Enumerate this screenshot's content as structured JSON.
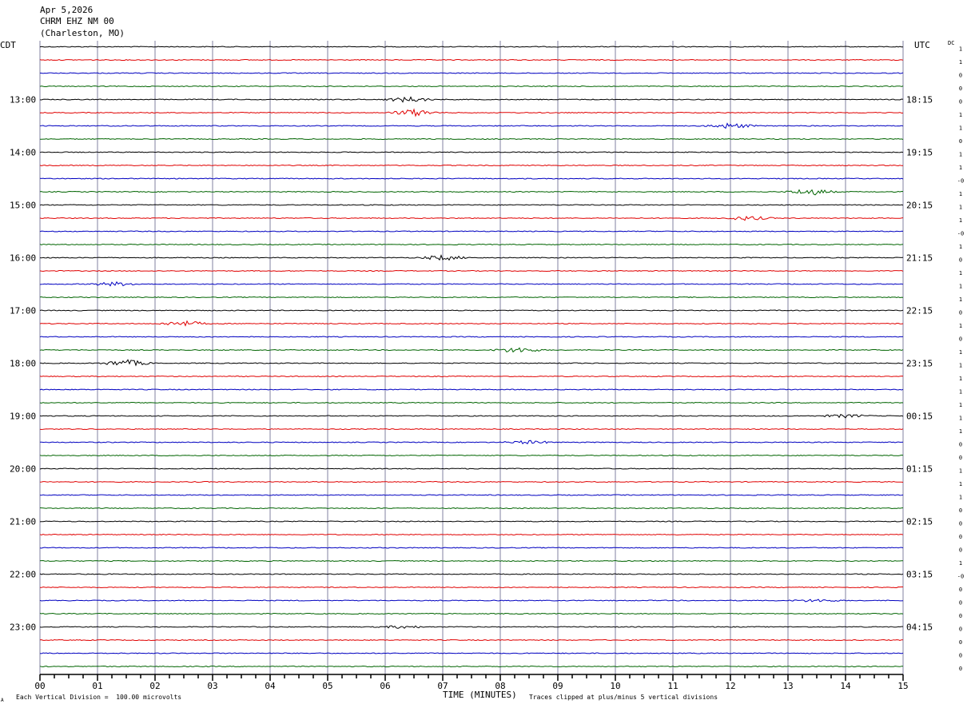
{
  "header": {
    "date": "Apr 5,2026",
    "station": "CHRM EHZ NM 00",
    "location": "(Charleston, MO)"
  },
  "left_axis_label": "CDT",
  "right_axis_label": "UTC",
  "dc_label": "DC",
  "footer": {
    "left_note": "Each Vertical Division =  100.00 microvolts",
    "xlabel": "TIME (MINUTES)",
    "right_note": "Traces clipped at plus/minus 5 vertical divisions",
    "corner_mark": "A"
  },
  "colors": {
    "trace_cycle": [
      "#000000",
      "#e00000",
      "#0000c0",
      "#006400"
    ],
    "vertical_grid": "#8080a0",
    "axis": "#000000"
  },
  "chart_data": {
    "type": "line",
    "title": "",
    "xlabel": "TIME (MINUTES)",
    "ylabel": "",
    "xlim": [
      0,
      15
    ],
    "x_ticks": [
      "00",
      "01",
      "02",
      "03",
      "04",
      "05",
      "06",
      "07",
      "08",
      "09",
      "10",
      "11",
      "12",
      "13",
      "14",
      "15"
    ],
    "trace_count": 48,
    "minutes_per_trace": 15,
    "first_trace_cdt": "12:15",
    "left_hour_labels": [
      {
        "trace": 4,
        "label": "13:00"
      },
      {
        "trace": 8,
        "label": "14:00"
      },
      {
        "trace": 12,
        "label": "15:00"
      },
      {
        "trace": 16,
        "label": "16:00"
      },
      {
        "trace": 20,
        "label": "17:00"
      },
      {
        "trace": 24,
        "label": "18:00"
      },
      {
        "trace": 28,
        "label": "19:00"
      },
      {
        "trace": 32,
        "label": "20:00"
      },
      {
        "trace": 36,
        "label": "21:00"
      },
      {
        "trace": 40,
        "label": "22:00"
      },
      {
        "trace": 44,
        "label": "23:00"
      }
    ],
    "right_hour_labels": [
      {
        "trace": 4,
        "label": "18:15"
      },
      {
        "trace": 8,
        "label": "19:15"
      },
      {
        "trace": 12,
        "label": "20:15"
      },
      {
        "trace": 16,
        "label": "21:15"
      },
      {
        "trace": 20,
        "label": "22:15"
      },
      {
        "trace": 24,
        "label": "23:15"
      },
      {
        "trace": 28,
        "label": "00:15"
      },
      {
        "trace": 32,
        "label": "01:15"
      },
      {
        "trace": 36,
        "label": "02:15"
      },
      {
        "trace": 40,
        "label": "03:15"
      },
      {
        "trace": 44,
        "label": "04:15"
      }
    ],
    "dc_offsets": [
      "1",
      "1",
      "0",
      "0",
      "0",
      "1",
      "1",
      "0",
      "1",
      "1",
      "-0",
      "1",
      "1",
      "1",
      "-0",
      "1",
      "0",
      "1",
      "1",
      "1",
      "0",
      "1",
      "0",
      "1",
      "1",
      "1",
      "1",
      "1",
      "1",
      "1",
      "0",
      "0",
      "1",
      "1",
      "1",
      "0",
      "0",
      "0",
      "0",
      "1",
      "-0",
      "0",
      "0",
      "0",
      "0",
      "0",
      "0",
      "0"
    ],
    "trace_activity": [
      {
        "trace": 4,
        "burst_minute": 6.4,
        "burst_amp": 2.0
      },
      {
        "trace": 5,
        "burst_minute": 6.5,
        "burst_amp": 2.5
      },
      {
        "trace": 6,
        "burst_minute": 12.0,
        "burst_amp": 2.0
      },
      {
        "trace": 11,
        "burst_minute": 13.4,
        "burst_amp": 2.5
      },
      {
        "trace": 13,
        "burst_minute": 12.3,
        "burst_amp": 1.5
      },
      {
        "trace": 16,
        "burst_minute": 7.0,
        "burst_amp": 1.8
      },
      {
        "trace": 18,
        "burst_minute": 1.3,
        "burst_amp": 1.5
      },
      {
        "trace": 21,
        "burst_minute": 2.5,
        "burst_amp": 2.0
      },
      {
        "trace": 23,
        "burst_minute": 8.3,
        "burst_amp": 2.0
      },
      {
        "trace": 24,
        "burst_minute": 1.5,
        "burst_amp": 2.5
      },
      {
        "trace": 28,
        "burst_minute": 14.0,
        "burst_amp": 1.2
      },
      {
        "trace": 30,
        "burst_minute": 8.5,
        "burst_amp": 1.2
      },
      {
        "trace": 42,
        "burst_minute": 13.5,
        "burst_amp": 1.0
      },
      {
        "trace": 44,
        "burst_minute": 6.3,
        "burst_amp": 1.0
      }
    ]
  }
}
